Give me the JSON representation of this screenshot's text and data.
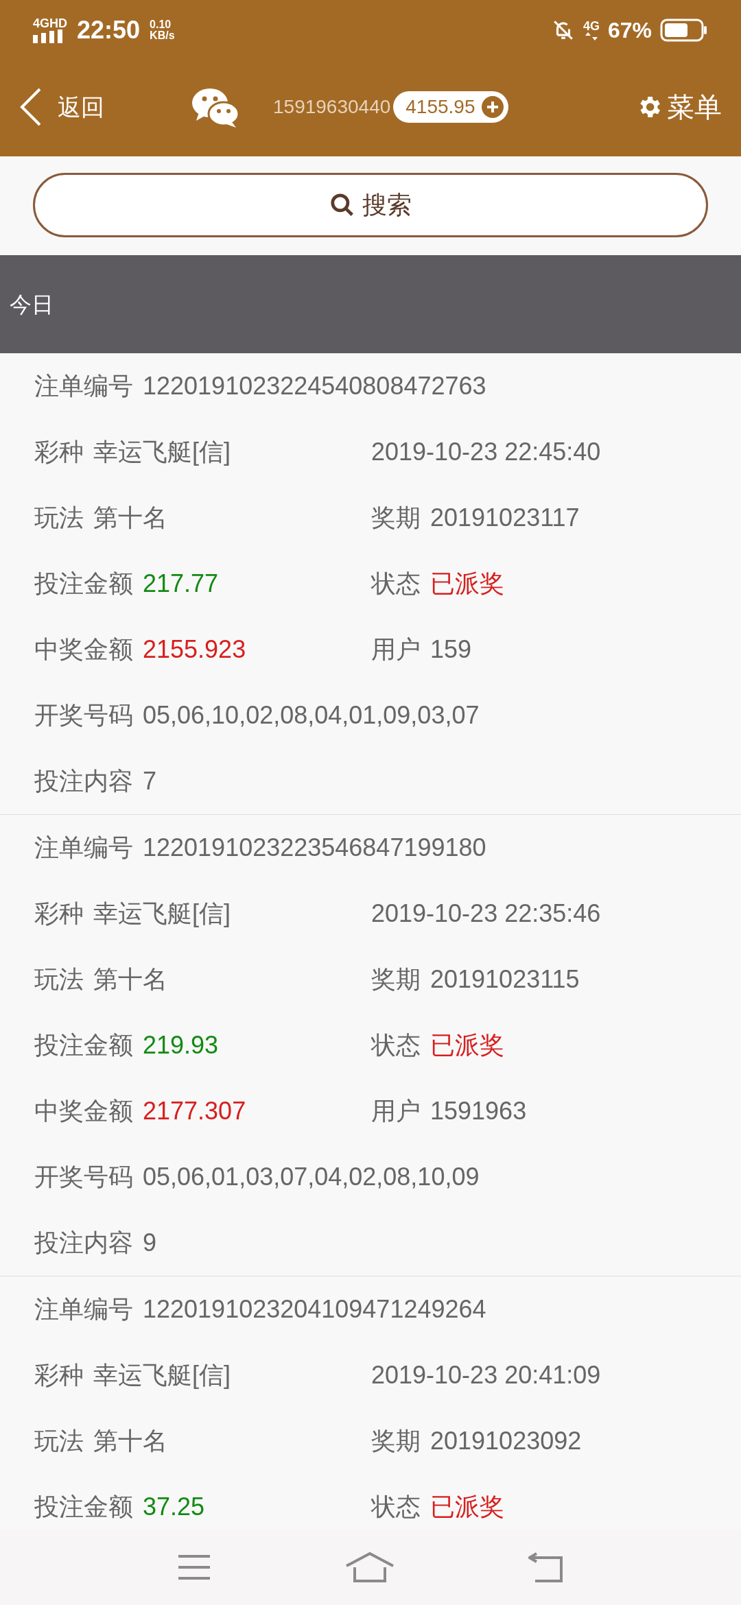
{
  "status_bar": {
    "network": "4GHD",
    "time": "22:50",
    "speed_value": "0.10",
    "speed_unit": "KB/s",
    "data_type": "4G",
    "battery": "67%"
  },
  "header": {
    "back_label": "返回",
    "account": "15919630440",
    "balance": "4155.95",
    "menu_label": "菜单"
  },
  "search": {
    "label": "搜索"
  },
  "tabs": [
    {
      "label": "今日",
      "selected": true
    }
  ],
  "records": [
    {
      "rows": [
        [
          {
            "label": "注单编号",
            "value": "1220191023224540808472763",
            "color": "#666666"
          }
        ],
        [
          {
            "label": "彩种",
            "value": "幸运飞艇[信]",
            "color": "#666666"
          },
          {
            "value": "2019-10-23 22:45:40",
            "color": "#666666"
          }
        ],
        [
          {
            "label": "玩法",
            "value": "第十名",
            "color": "#666666"
          },
          {
            "label": "奖期",
            "value": "20191023117",
            "color": "#666666"
          }
        ],
        [
          {
            "label": "投注金额",
            "value": "217.77",
            "color": "#138a13"
          },
          {
            "label": "状态",
            "value": "已派奖",
            "color": "#d81e1e"
          }
        ],
        [
          {
            "label": "中奖金额",
            "value": "2155.923",
            "color": "#d81e1e"
          },
          {
            "label": "用户",
            "value": "159",
            "color": "#666666"
          }
        ],
        [
          {
            "label": "开奖号码",
            "value": "05,06,10,02,08,04,01,09,03,07",
            "color": "#666666"
          }
        ],
        [
          {
            "label": "投注内容",
            "value": "7",
            "color": "#666666"
          }
        ]
      ]
    },
    {
      "rows": [
        [
          {
            "label": "注单编号",
            "value": "1220191023223546847199180",
            "color": "#666666"
          }
        ],
        [
          {
            "label": "彩种",
            "value": "幸运飞艇[信]",
            "color": "#666666"
          },
          {
            "value": "2019-10-23 22:35:46",
            "color": "#666666"
          }
        ],
        [
          {
            "label": "玩法",
            "value": "第十名",
            "color": "#666666"
          },
          {
            "label": "奖期",
            "value": "20191023115",
            "color": "#666666"
          }
        ],
        [
          {
            "label": "投注金额",
            "value": "219.93",
            "color": "#138a13"
          },
          {
            "label": "状态",
            "value": "已派奖",
            "color": "#d81e1e"
          }
        ],
        [
          {
            "label": "中奖金额",
            "value": "2177.307",
            "color": "#d81e1e"
          },
          {
            "label": "用户",
            "value": "1591963",
            "color": "#666666"
          }
        ],
        [
          {
            "label": "开奖号码",
            "value": "05,06,01,03,07,04,02,08,10,09",
            "color": "#666666"
          }
        ],
        [
          {
            "label": "投注内容",
            "value": "9",
            "color": "#666666"
          }
        ]
      ]
    },
    {
      "rows": [
        [
          {
            "label": "注单编号",
            "value": "1220191023204109471249264",
            "color": "#666666"
          }
        ],
        [
          {
            "label": "彩种",
            "value": "幸运飞艇[信]",
            "color": "#666666"
          },
          {
            "value": "2019-10-23 20:41:09",
            "color": "#666666"
          }
        ],
        [
          {
            "label": "玩法",
            "value": "第十名",
            "color": "#666666"
          },
          {
            "label": "奖期",
            "value": "20191023092",
            "color": "#666666"
          }
        ],
        [
          {
            "label": "投注金额",
            "value": "37.25",
            "color": "#138a13"
          },
          {
            "label": "状态",
            "value": "已派奖",
            "color": "#d81e1e"
          }
        ]
      ]
    }
  ]
}
